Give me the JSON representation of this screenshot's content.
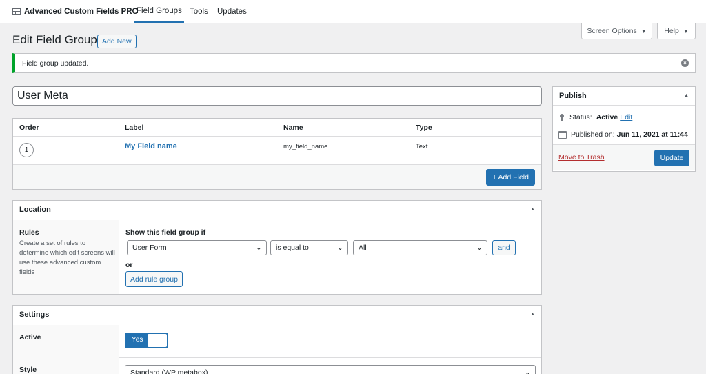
{
  "topbar": {
    "brand": "Advanced Custom Fields PRO",
    "brand_icon": "table-icon",
    "tabs": [
      {
        "label": "Field Groups",
        "active": true
      },
      {
        "label": "Tools",
        "active": false
      },
      {
        "label": "Updates",
        "active": false
      }
    ]
  },
  "screen_options": {
    "label": "Screen Options",
    "icon": "caret-down-icon"
  },
  "help": {
    "label": "Help",
    "icon": "caret-down-icon"
  },
  "heading": {
    "title": "Edit Field Group",
    "add_new": "Add New"
  },
  "notice": {
    "text": "Field group updated.",
    "dismiss_icon": "dismiss-icon"
  },
  "title_input": {
    "value": "User Meta"
  },
  "fields_table": {
    "columns": [
      "Order",
      "Label",
      "Name",
      "Type"
    ],
    "rows": [
      {
        "order": "1",
        "label": "My Field name",
        "name": "my_field_name",
        "type": "Text"
      }
    ],
    "add_field": "+ Add Field"
  },
  "location": {
    "title": "Location",
    "rules_title": "Rules",
    "rules_desc": "Create a set of rules to determine which edit screens will use these advanced custom fields",
    "condition_label": "Show this field group if",
    "param": "User Form",
    "operator": "is equal to",
    "value": "All",
    "and_label": "and",
    "or_label": "or",
    "add_rule_group": "Add rule group"
  },
  "settings": {
    "title": "Settings",
    "active_label": "Active",
    "active_value": "Yes",
    "style_label": "Style",
    "style_value": "Standard (WP metabox)"
  },
  "publish": {
    "title": "Publish",
    "status_label": "Status:",
    "status_value": "Active",
    "edit_link": "Edit",
    "published_label": "Published on:",
    "published_value": "Jun 11, 2021 at 11:44",
    "trash": "Move to Trash",
    "update": "Update"
  },
  "colors": {
    "accent": "#2271b1",
    "success": "#00a32a",
    "danger": "#b32d2e"
  }
}
